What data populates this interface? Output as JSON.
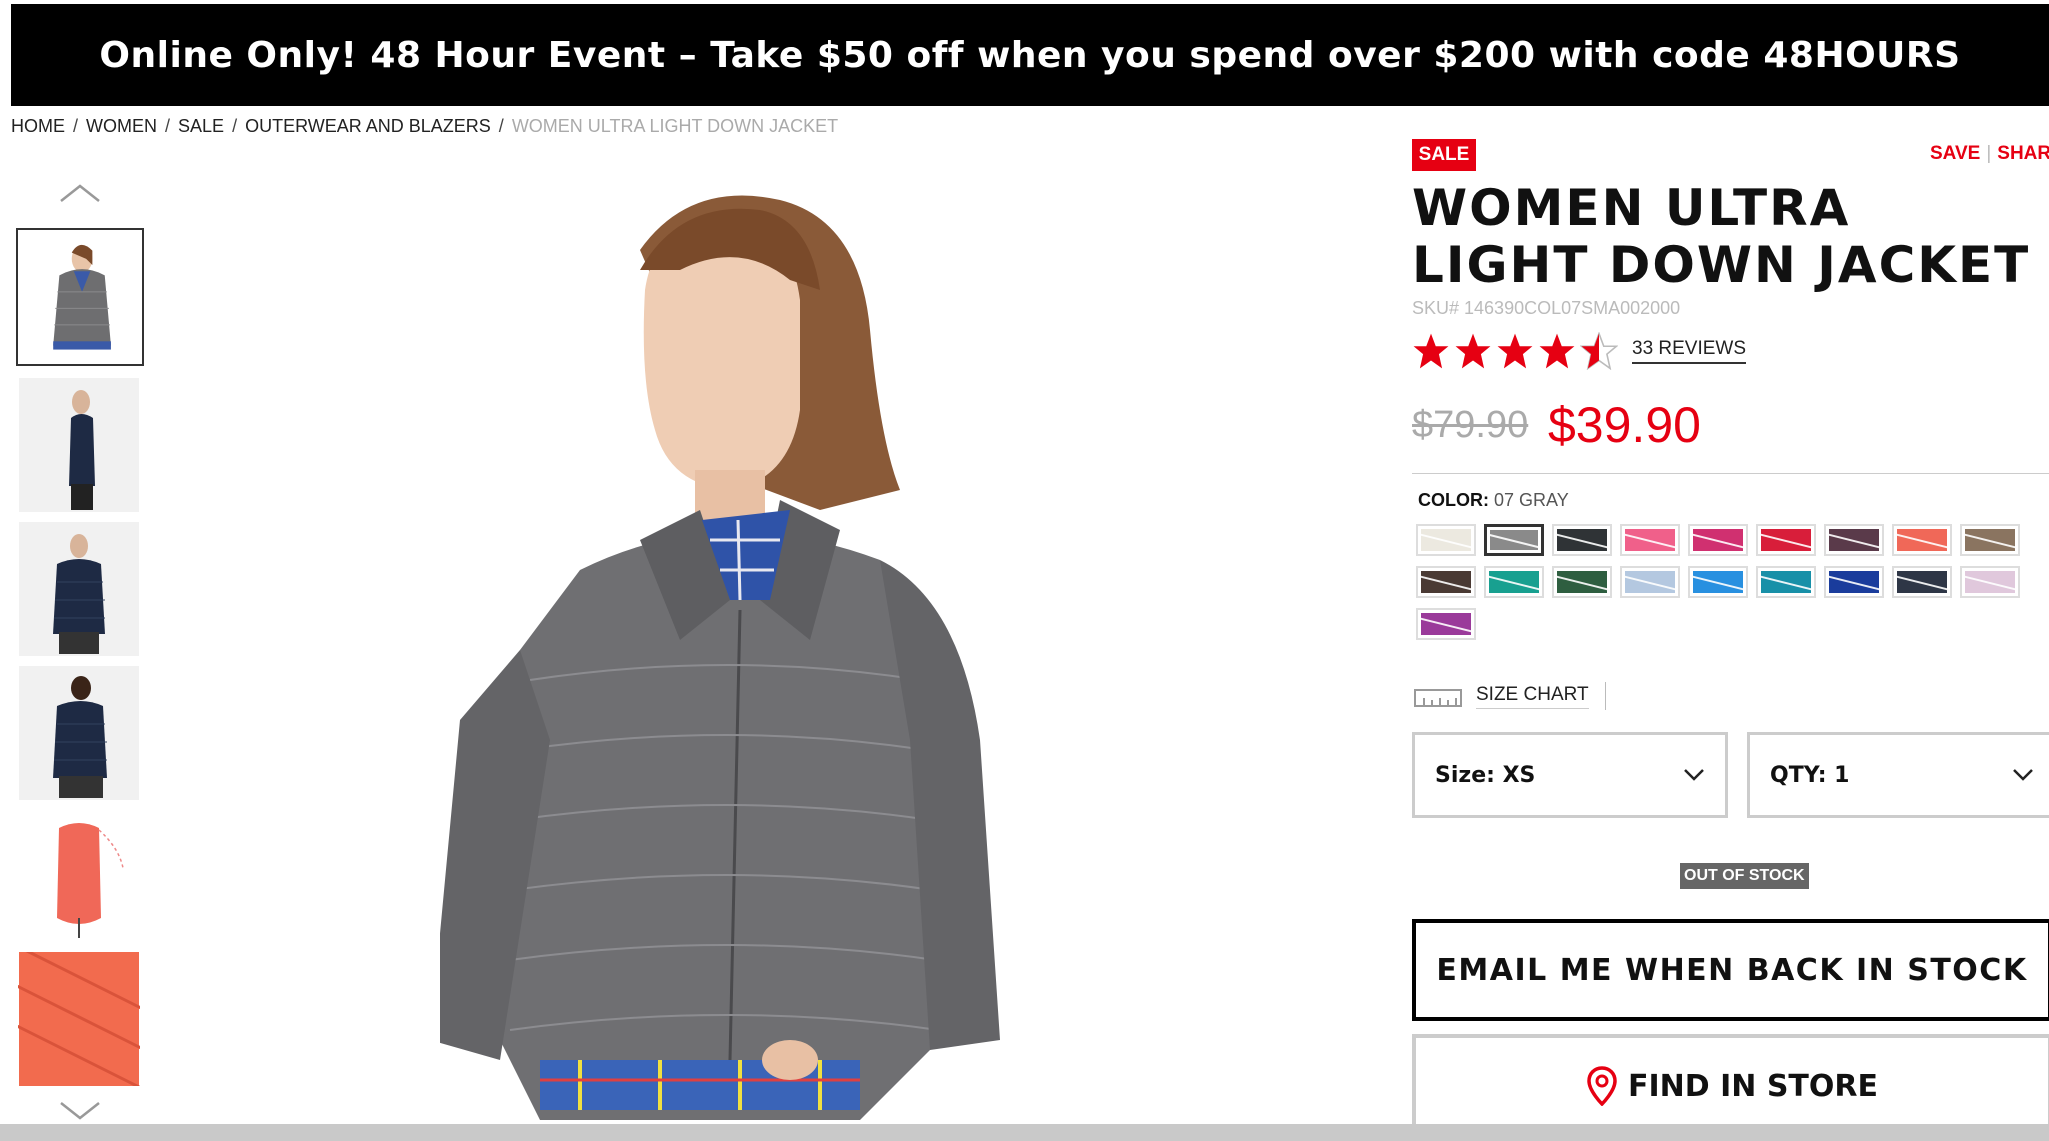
{
  "promo": {
    "text": "Online Only! 48 Hour Event – Take $50 off when you spend over $200 with code 48HOURS"
  },
  "breadcrumb": [
    "HOME",
    "WOMEN",
    "SALE",
    "OUTERWEAR AND BLAZERS",
    "WOMEN ULTRA LIGHT DOWN JACKET"
  ],
  "breadcrumb_sep": "/",
  "product": {
    "sale_badge": "SALE",
    "save_label": "SAVE",
    "share_label": "SHAR",
    "title": "WOMEN ULTRA LIGHT DOWN JACKET",
    "sku": "SKU# 146390COL07SMA002000",
    "rating": 4.5,
    "reviews_label": "33 REVIEWS",
    "old_price": "$79.90",
    "new_price": "$39.90",
    "color_label": "COLOR:",
    "color_value": "07 GRAY",
    "swatches": [
      {
        "color": "#ece9e0"
      },
      {
        "color": "#8a8a8a",
        "selected": true
      },
      {
        "color": "#2f3336"
      },
      {
        "color": "#f0608a"
      },
      {
        "color": "#d03070"
      },
      {
        "color": "#d81e3a"
      },
      {
        "color": "#5a3a4a"
      },
      {
        "color": "#f06858"
      },
      {
        "color": "#8a7460"
      },
      {
        "color": "#4a3a34"
      },
      {
        "color": "#18a090"
      },
      {
        "color": "#2e5e40"
      },
      {
        "color": "#b4c8e0"
      },
      {
        "color": "#2890e0"
      },
      {
        "color": "#1890a8"
      },
      {
        "color": "#1a3c9c"
      },
      {
        "color": "#2e3646"
      },
      {
        "color": "#e0c8dc"
      },
      {
        "color": "#9a3a9a"
      }
    ],
    "size_chart_label": "SIZE CHART",
    "size_select": "Size: XS",
    "qty_select": "QTY: 1",
    "stock_badge": "OUT OF STOCK",
    "email_button": "EMAIL ME WHEN BACK IN STOCK",
    "store_button": "FIND IN STORE"
  },
  "icons": {
    "thumb_up": "chevron-up-icon",
    "thumb_down": "chevron-down-icon",
    "select_arrow": "chevron-down-icon",
    "store": "map-pin-icon",
    "size_chart": "ruler-icon"
  },
  "colors": {
    "accent": "#e60012",
    "promo_bg": "#000000"
  }
}
